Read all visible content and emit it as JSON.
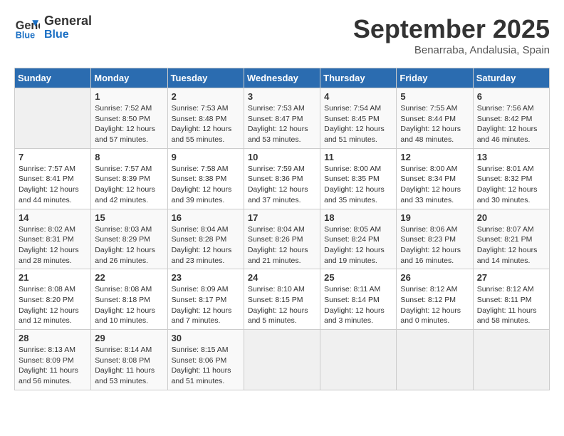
{
  "header": {
    "logo_line1": "General",
    "logo_line2": "Blue",
    "month_year": "September 2025",
    "location": "Benarraba, Andalusia, Spain"
  },
  "days_of_week": [
    "Sunday",
    "Monday",
    "Tuesday",
    "Wednesday",
    "Thursday",
    "Friday",
    "Saturday"
  ],
  "weeks": [
    [
      {
        "day": "",
        "info": ""
      },
      {
        "day": "1",
        "info": "Sunrise: 7:52 AM\nSunset: 8:50 PM\nDaylight: 12 hours\nand 57 minutes."
      },
      {
        "day": "2",
        "info": "Sunrise: 7:53 AM\nSunset: 8:48 PM\nDaylight: 12 hours\nand 55 minutes."
      },
      {
        "day": "3",
        "info": "Sunrise: 7:53 AM\nSunset: 8:47 PM\nDaylight: 12 hours\nand 53 minutes."
      },
      {
        "day": "4",
        "info": "Sunrise: 7:54 AM\nSunset: 8:45 PM\nDaylight: 12 hours\nand 51 minutes."
      },
      {
        "day": "5",
        "info": "Sunrise: 7:55 AM\nSunset: 8:44 PM\nDaylight: 12 hours\nand 48 minutes."
      },
      {
        "day": "6",
        "info": "Sunrise: 7:56 AM\nSunset: 8:42 PM\nDaylight: 12 hours\nand 46 minutes."
      }
    ],
    [
      {
        "day": "7",
        "info": "Sunrise: 7:57 AM\nSunset: 8:41 PM\nDaylight: 12 hours\nand 44 minutes."
      },
      {
        "day": "8",
        "info": "Sunrise: 7:57 AM\nSunset: 8:39 PM\nDaylight: 12 hours\nand 42 minutes."
      },
      {
        "day": "9",
        "info": "Sunrise: 7:58 AM\nSunset: 8:38 PM\nDaylight: 12 hours\nand 39 minutes."
      },
      {
        "day": "10",
        "info": "Sunrise: 7:59 AM\nSunset: 8:36 PM\nDaylight: 12 hours\nand 37 minutes."
      },
      {
        "day": "11",
        "info": "Sunrise: 8:00 AM\nSunset: 8:35 PM\nDaylight: 12 hours\nand 35 minutes."
      },
      {
        "day": "12",
        "info": "Sunrise: 8:00 AM\nSunset: 8:34 PM\nDaylight: 12 hours\nand 33 minutes."
      },
      {
        "day": "13",
        "info": "Sunrise: 8:01 AM\nSunset: 8:32 PM\nDaylight: 12 hours\nand 30 minutes."
      }
    ],
    [
      {
        "day": "14",
        "info": "Sunrise: 8:02 AM\nSunset: 8:31 PM\nDaylight: 12 hours\nand 28 minutes."
      },
      {
        "day": "15",
        "info": "Sunrise: 8:03 AM\nSunset: 8:29 PM\nDaylight: 12 hours\nand 26 minutes."
      },
      {
        "day": "16",
        "info": "Sunrise: 8:04 AM\nSunset: 8:28 PM\nDaylight: 12 hours\nand 23 minutes."
      },
      {
        "day": "17",
        "info": "Sunrise: 8:04 AM\nSunset: 8:26 PM\nDaylight: 12 hours\nand 21 minutes."
      },
      {
        "day": "18",
        "info": "Sunrise: 8:05 AM\nSunset: 8:24 PM\nDaylight: 12 hours\nand 19 minutes."
      },
      {
        "day": "19",
        "info": "Sunrise: 8:06 AM\nSunset: 8:23 PM\nDaylight: 12 hours\nand 16 minutes."
      },
      {
        "day": "20",
        "info": "Sunrise: 8:07 AM\nSunset: 8:21 PM\nDaylight: 12 hours\nand 14 minutes."
      }
    ],
    [
      {
        "day": "21",
        "info": "Sunrise: 8:08 AM\nSunset: 8:20 PM\nDaylight: 12 hours\nand 12 minutes."
      },
      {
        "day": "22",
        "info": "Sunrise: 8:08 AM\nSunset: 8:18 PM\nDaylight: 12 hours\nand 10 minutes."
      },
      {
        "day": "23",
        "info": "Sunrise: 8:09 AM\nSunset: 8:17 PM\nDaylight: 12 hours\nand 7 minutes."
      },
      {
        "day": "24",
        "info": "Sunrise: 8:10 AM\nSunset: 8:15 PM\nDaylight: 12 hours\nand 5 minutes."
      },
      {
        "day": "25",
        "info": "Sunrise: 8:11 AM\nSunset: 8:14 PM\nDaylight: 12 hours\nand 3 minutes."
      },
      {
        "day": "26",
        "info": "Sunrise: 8:12 AM\nSunset: 8:12 PM\nDaylight: 12 hours\nand 0 minutes."
      },
      {
        "day": "27",
        "info": "Sunrise: 8:12 AM\nSunset: 8:11 PM\nDaylight: 11 hours\nand 58 minutes."
      }
    ],
    [
      {
        "day": "28",
        "info": "Sunrise: 8:13 AM\nSunset: 8:09 PM\nDaylight: 11 hours\nand 56 minutes."
      },
      {
        "day": "29",
        "info": "Sunrise: 8:14 AM\nSunset: 8:08 PM\nDaylight: 11 hours\nand 53 minutes."
      },
      {
        "day": "30",
        "info": "Sunrise: 8:15 AM\nSunset: 8:06 PM\nDaylight: 11 hours\nand 51 minutes."
      },
      {
        "day": "",
        "info": ""
      },
      {
        "day": "",
        "info": ""
      },
      {
        "day": "",
        "info": ""
      },
      {
        "day": "",
        "info": ""
      }
    ]
  ]
}
